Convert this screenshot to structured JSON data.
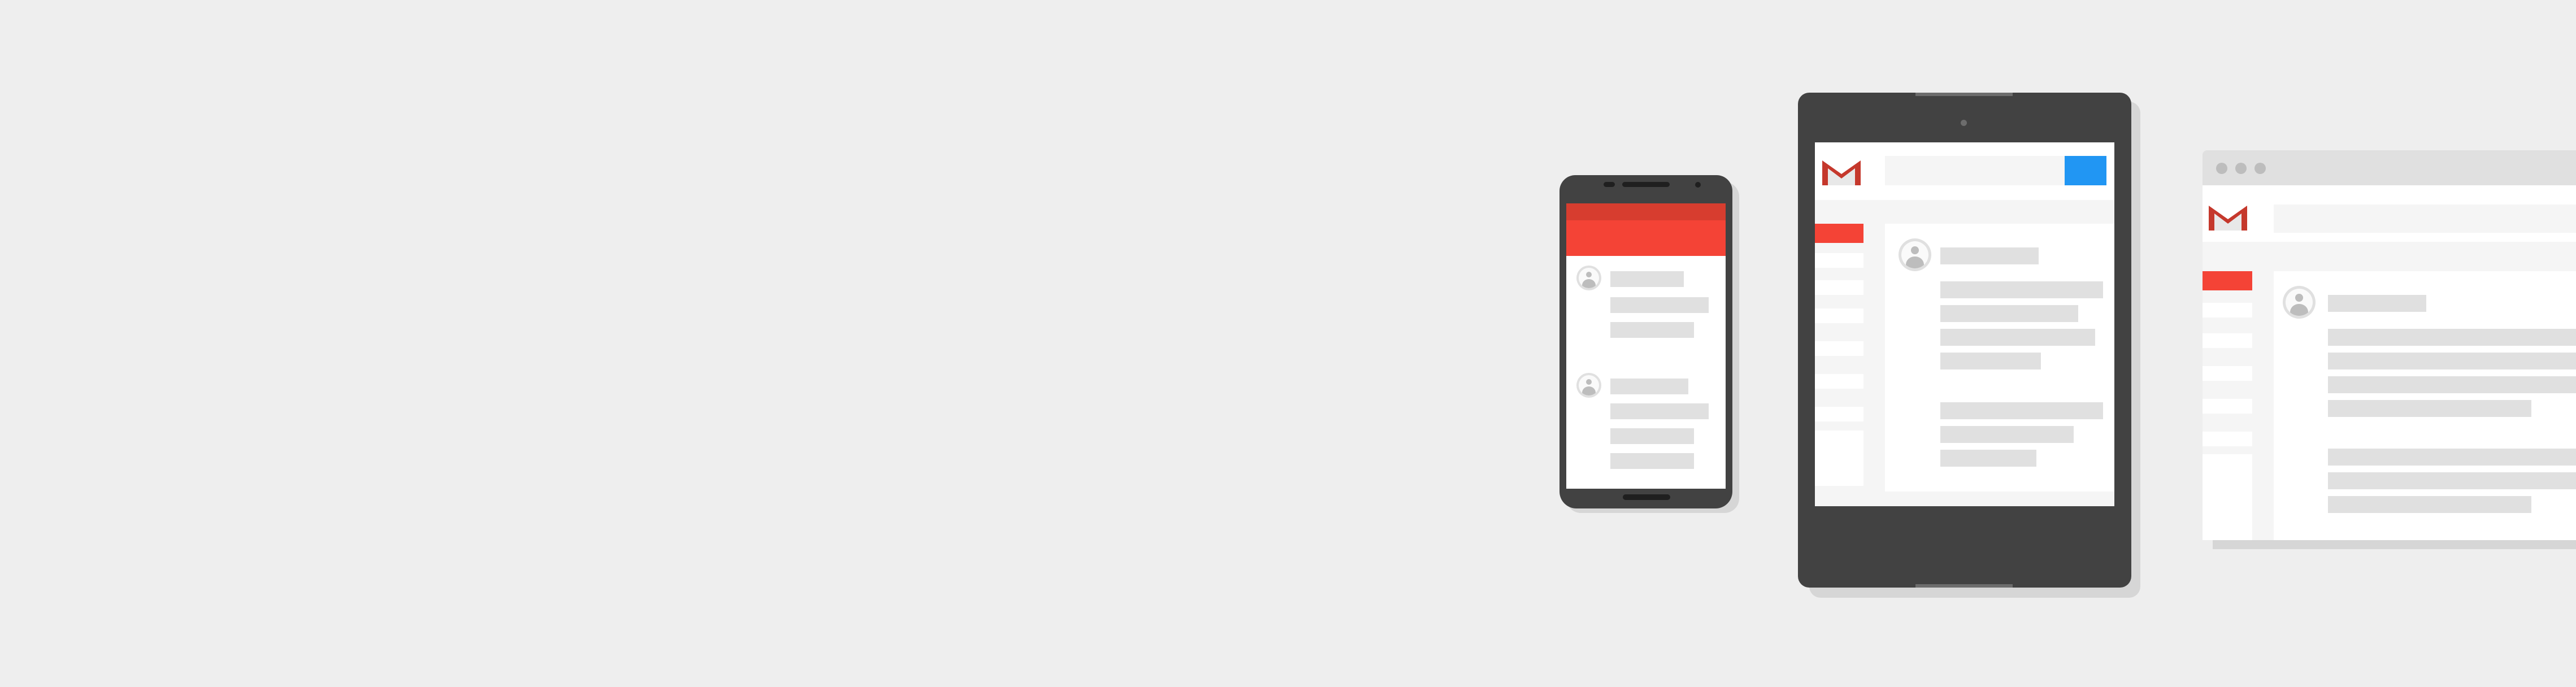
{
  "scene": {
    "description_free": true,
    "colors": {
      "background": "#eeeeee",
      "device_frame": "#424242",
      "device_shadow": "#d6d6d6",
      "screen": "#ffffff",
      "panel": "#f5f5f5",
      "placeholder": "#e0e0e0",
      "accent_red": "#f44336",
      "accent_red_dark": "#d73d2f",
      "accent_blue": "#2196f3",
      "browser_chrome": "#e0e0e0",
      "browser_dot": "#bdbdbd"
    },
    "icons": {
      "gmail_logo": "gmail-m-logo",
      "contact": "account-circle-icon"
    }
  }
}
